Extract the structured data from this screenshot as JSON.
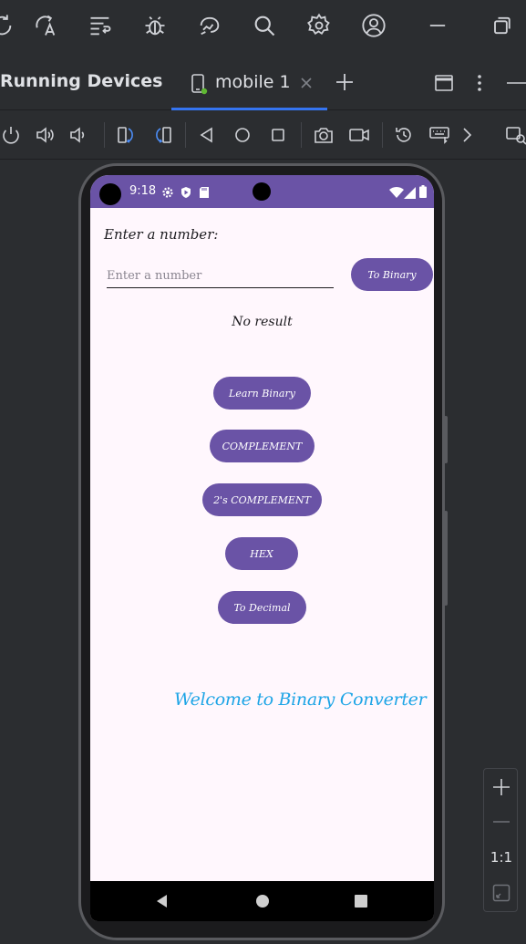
{
  "ide": {
    "panel_title": "Running Devices",
    "device_tab_label": "mobile 1",
    "zoom_label": "1:1"
  },
  "phone": {
    "status_time": "9:18"
  },
  "app": {
    "prompt_label": "Enter a number:",
    "input_value": "",
    "input_placeholder": "Enter a number",
    "to_binary_label": "To Binary",
    "result_text": "No result",
    "buttons": {
      "learn_binary": "Learn Binary",
      "complement": "COMPLEMENT",
      "twos_complement": "2's COMPLEMENT",
      "hex": "HEX",
      "to_decimal": "To Decimal"
    },
    "welcome_text": "Welcome to Binary Converter"
  },
  "colors": {
    "accent": "#6a53a6",
    "welcome": "#1ea5e6",
    "ide_bg": "#2b2d30",
    "tab_underline": "#3574f0"
  }
}
